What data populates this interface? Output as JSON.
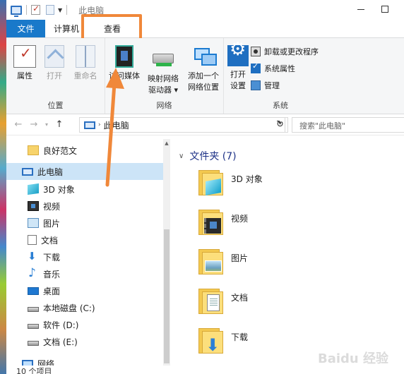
{
  "window": {
    "title": "此电脑"
  },
  "tabs": {
    "file": "文件",
    "computer": "计算机",
    "view": "查看"
  },
  "ribbon": {
    "location": {
      "label": "位置",
      "properties": "属性",
      "open": "打开",
      "rename": "重命名"
    },
    "network": {
      "label": "网络",
      "media_line1": "访问媒体",
      "map_drive_line1": "映射网络",
      "map_drive_line2": "驱动器",
      "add_location_line1": "添加一个",
      "add_location_line2": "网络位置"
    },
    "system": {
      "label": "系统",
      "open_settings_line1": "打开",
      "open_settings_line2": "设置",
      "uninstall": "卸载或更改程序",
      "system_properties": "系统属性",
      "manage": "管理"
    }
  },
  "address": {
    "path": "此电脑",
    "search_placeholder": "搜索\"此电脑\""
  },
  "nav_pane": {
    "items": [
      {
        "label": "良好范文",
        "icon": "folder-icon"
      },
      {
        "label": "此电脑",
        "icon": "this-pc-icon"
      },
      {
        "label": "3D 对象",
        "icon": "3d-objects-icon"
      },
      {
        "label": "视频",
        "icon": "video-icon"
      },
      {
        "label": "图片",
        "icon": "pictures-icon"
      },
      {
        "label": "文档",
        "icon": "documents-icon"
      },
      {
        "label": "下载",
        "icon": "download-icon"
      },
      {
        "label": "音乐",
        "icon": "music-icon"
      },
      {
        "label": "桌面",
        "icon": "desktop-icon"
      },
      {
        "label": "本地磁盘 (C:)",
        "icon": "drive-icon"
      },
      {
        "label": "软件 (D:)",
        "icon": "drive-icon"
      },
      {
        "label": "文档 (E:)",
        "icon": "drive-icon"
      },
      {
        "label": "网络",
        "icon": "network-icon"
      }
    ]
  },
  "content": {
    "section_title": "文件夹 (7)",
    "folders": [
      {
        "name": "3D 对象"
      },
      {
        "name": "视频"
      },
      {
        "name": "图片"
      },
      {
        "name": "文档"
      },
      {
        "name": "下载"
      }
    ]
  },
  "status": {
    "item_count": "10 个项目"
  },
  "watermark": "Baidu 经验",
  "colors": {
    "accent": "#1979ca",
    "highlight": "#f0883a",
    "selection": "#cce4f7"
  }
}
